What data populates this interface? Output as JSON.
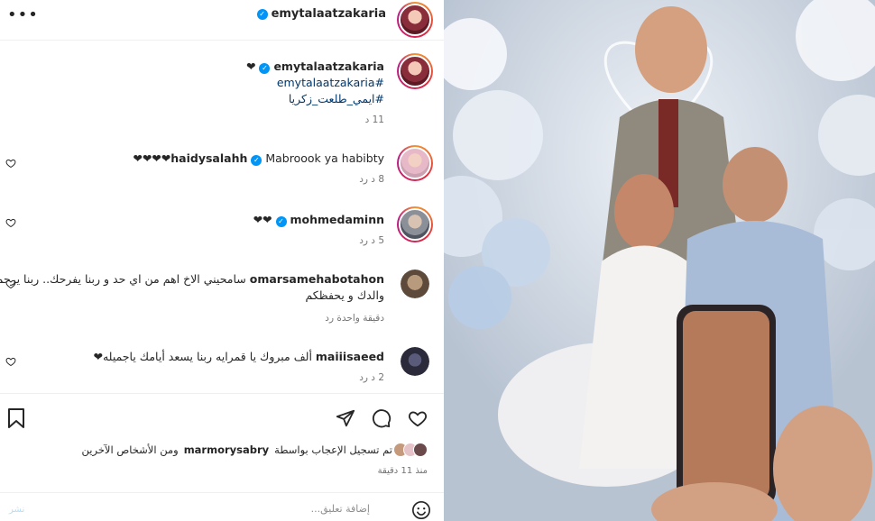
{
  "post": {
    "author": "emytalaatzakaria",
    "caption": {
      "text_suffix": "❤",
      "hashtag1": "#emytalaatzakaria",
      "hashtag2": "#ايمي_طلعت_زكريا",
      "time": "11 د"
    }
  },
  "comments": [
    {
      "user": "haidysalahh",
      "text": "Mabroook ya habibty❤❤❤❤",
      "time": "8 د",
      "reply": "رد"
    },
    {
      "user": "mohmedaminn",
      "text": "❤❤",
      "time": "5 د",
      "reply": "رد"
    },
    {
      "user": "omarsamehabotahon",
      "text": "سامحيني الاخ اهم من اي حد و ربنا يفرحك.. ربنا يرحم والدك و يحفظكم",
      "time": "دقيقة واحدة",
      "reply": "رد"
    },
    {
      "user": "maiiisaeed",
      "text": "ألف مبروك يا قمرايه ربنا يسعد أيامك ياجميله❤",
      "time": "2 د",
      "reply": "رد"
    }
  ],
  "likes": {
    "text_prefix": "تم تسجيل الإعجاب بواسطة",
    "user": "marmorysabry",
    "text_suffix": "ومن الأشخاص الآخرين",
    "time_ago": "منذ 11 دقيقة"
  },
  "add_comment": {
    "placeholder": "إضافة تعليق...",
    "post_label": "نشر"
  },
  "icons": {
    "more": "more-horizontal-icon",
    "verified": "verified-badge-icon",
    "heart": "heart-icon",
    "comment": "comment-icon",
    "share": "share-icon",
    "bookmark": "bookmark-icon",
    "emoji": "emoji-icon"
  },
  "colors": {
    "verified": "#0095f6",
    "link": "#00376b",
    "muted": "#737373",
    "post_disabled": "#b2dffc"
  }
}
